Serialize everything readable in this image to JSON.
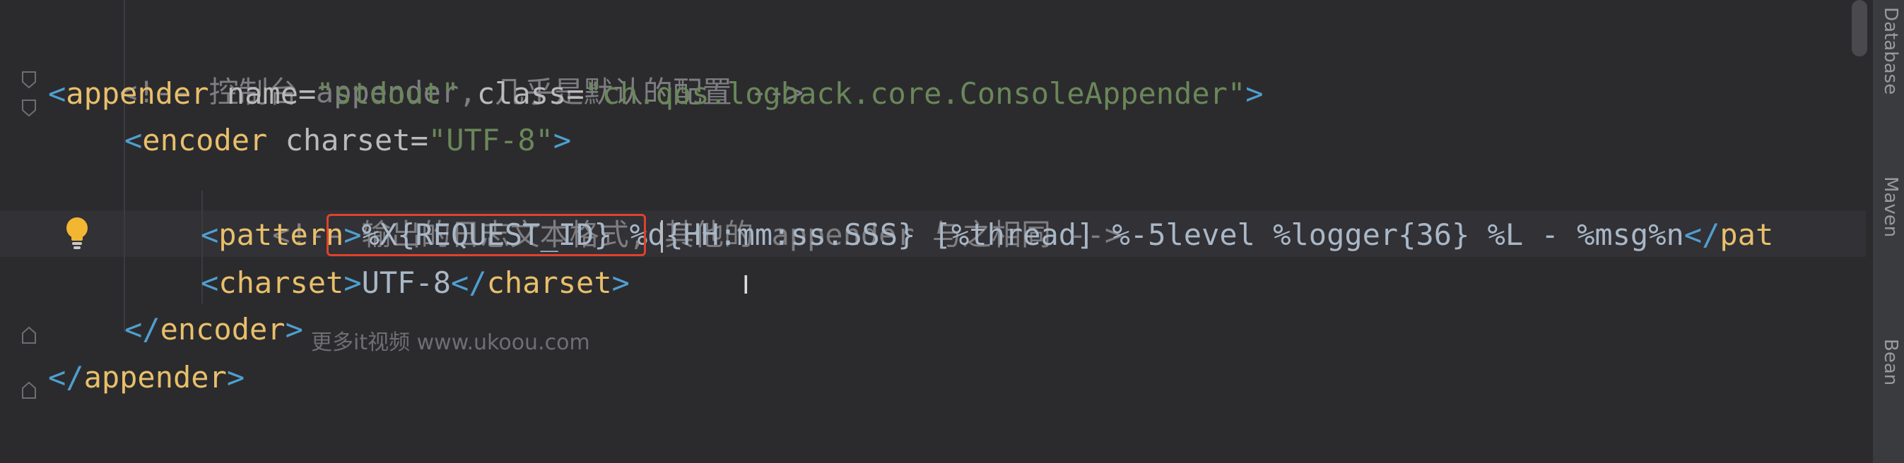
{
  "code": {
    "line1": {
      "comment": "<!-- 控制台 appender, 几乎是默认的配置 -->"
    },
    "line2": {
      "open": "<",
      "tag": "appender",
      "attr1": " name",
      "eq1": "=",
      "val1": "\"stdout\"",
      "attr2": " class",
      "eq2": "=",
      "val2": "\"ch.qos.logback.core.ConsoleAppender\"",
      "close": ">"
    },
    "line3": {
      "open": "<",
      "tag": "encoder",
      "attr1": " charset",
      "eq1": "=",
      "val1": "\"UTF-8\"",
      "close": ">"
    },
    "line4": {
      "comment": "<!-- 输出的日志文本格式, 其他的 appender 与之相同 -->"
    },
    "line5": {
      "open": "<",
      "tag": "pattern",
      "close": ">",
      "highlight_text": "%X{REQUEST_ID} ",
      "rest_text": "%d{HH:mm:ss.SSS} [%thread] %-5level %logger{36} %L - %msg%n",
      "end_open": "</",
      "end_tag": "pat"
    },
    "line6": {
      "open": "<",
      "tag": "charset",
      "close": ">",
      "text": "UTF-8",
      "end_open": "</",
      "end_tag": "charset",
      "end_close": ">"
    },
    "line7": {
      "open": "</",
      "tag": "encoder",
      "close": ">"
    },
    "line8": {
      "open": "</",
      "tag": "appender",
      "close": ">"
    }
  },
  "watermark": "更多it视频 www.ukoou.com",
  "right_tabs": [
    "Database",
    "Maven",
    "Bean"
  ],
  "colors": {
    "background": "#2b2b2e",
    "comment": "#7e7e82",
    "tag": "#e8bf6a",
    "attribute": "#bababa",
    "string": "#6a8759",
    "text": "#a9b7c6",
    "highlight_box": "#e0412b"
  },
  "icons": {
    "gutter_bulb": "lightbulb-icon",
    "fold_markers": "fold-icon"
  }
}
